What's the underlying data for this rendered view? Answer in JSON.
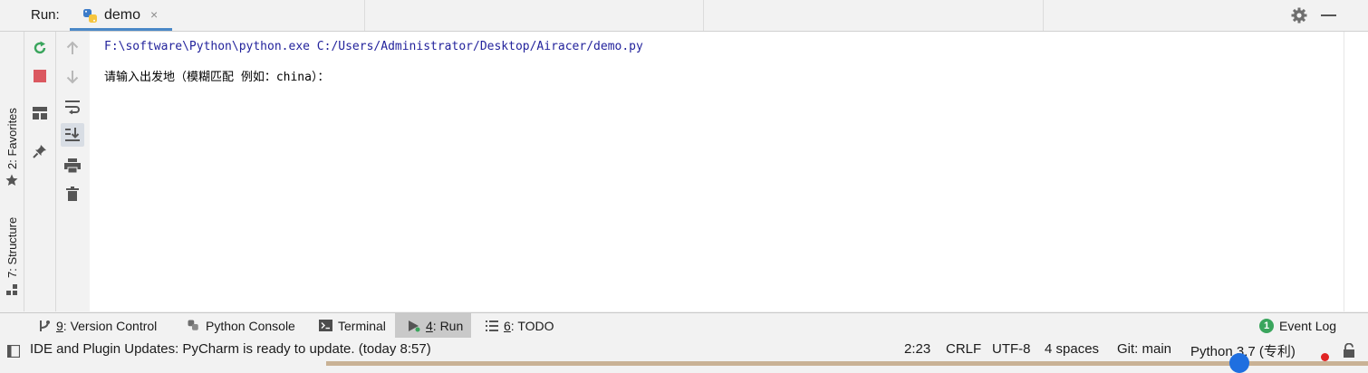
{
  "run_header": {
    "title": "Run:",
    "tab_label": "demo",
    "tab_close": "×",
    "gear_icon": "gear-icon",
    "minimize_icon": "minimize-icon"
  },
  "left_strip": {
    "favorites": "2: Favorites",
    "structure": "7: Structure"
  },
  "console": {
    "command": "F:\\software\\Python\\python.exe C:/Users/Administrator/Desktop/Airacer/demo.py",
    "prompt": "请输入出发地（模糊匹配 例如：china）："
  },
  "bottom_tabs": [
    {
      "num": "9",
      "label": ": Version Control",
      "icon": "version-control-icon"
    },
    {
      "num": "",
      "label": "Python Console",
      "icon": "python-console-icon"
    },
    {
      "num": "",
      "label": "Terminal",
      "icon": "terminal-icon"
    },
    {
      "num": "4",
      "label": ": Run",
      "icon": "run-icon"
    },
    {
      "num": "6",
      "label": ": TODO",
      "icon": "todo-icon"
    }
  ],
  "event_log": {
    "count": "1",
    "label": "Event Log"
  },
  "status_bar": {
    "message": "IDE and Plugin Updates: PyCharm is ready to update. (today 8:57)",
    "position": "2:23",
    "line_sep": "CRLF",
    "encoding": "UTF-8",
    "indent": "4 spaces",
    "git": "Git: main",
    "interpreter": "Python 3.7 (专利)"
  },
  "colors": {
    "accent": "#4a88c7",
    "command_text": "#23239c",
    "rerun_green": "#3aa55d",
    "stop_red": "#db5860"
  }
}
